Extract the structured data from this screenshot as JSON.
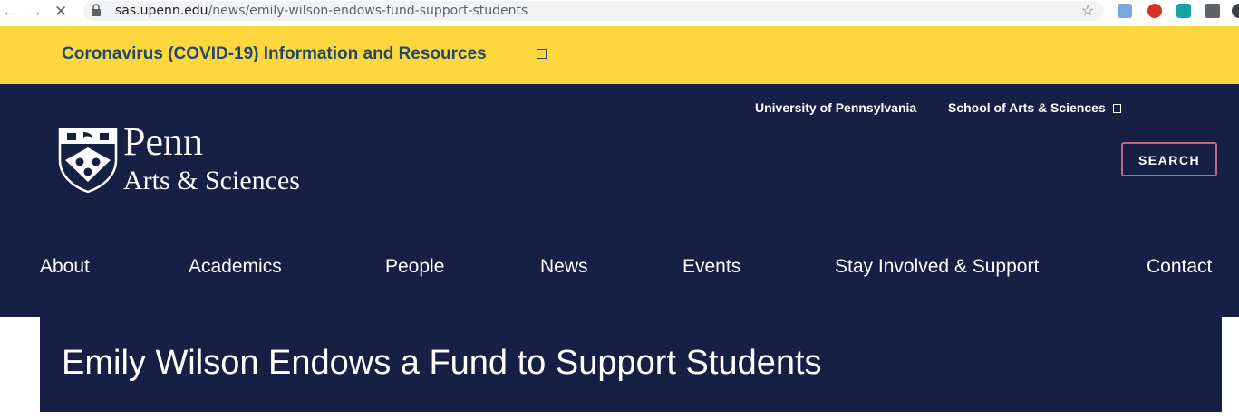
{
  "browser": {
    "url_host": "sas.upenn.edu",
    "url_path": "/news/emily-wilson-endows-fund-support-students"
  },
  "alert": {
    "text": "Coronavirus (COVID-19) Information and Resources"
  },
  "utility_nav": {
    "university": "University of Pennsylvania",
    "school": "School of Arts & Sciences"
  },
  "logo": {
    "line1": "Penn",
    "line2": "Arts & Sciences"
  },
  "search": {
    "label": "SEARCH"
  },
  "main_nav": [
    {
      "label": "About"
    },
    {
      "label": "Academics"
    },
    {
      "label": "People"
    },
    {
      "label": "News"
    },
    {
      "label": "Events"
    },
    {
      "label": "Stay Involved & Support"
    },
    {
      "label": "Contact"
    }
  ],
  "page": {
    "title": "Emily Wilson Endows a Fund to Support Students"
  },
  "colors": {
    "alert_bg": "#fed73f",
    "header_bg": "#152044",
    "alert_text": "#1f4a6e",
    "search_border": "#c26a75"
  }
}
